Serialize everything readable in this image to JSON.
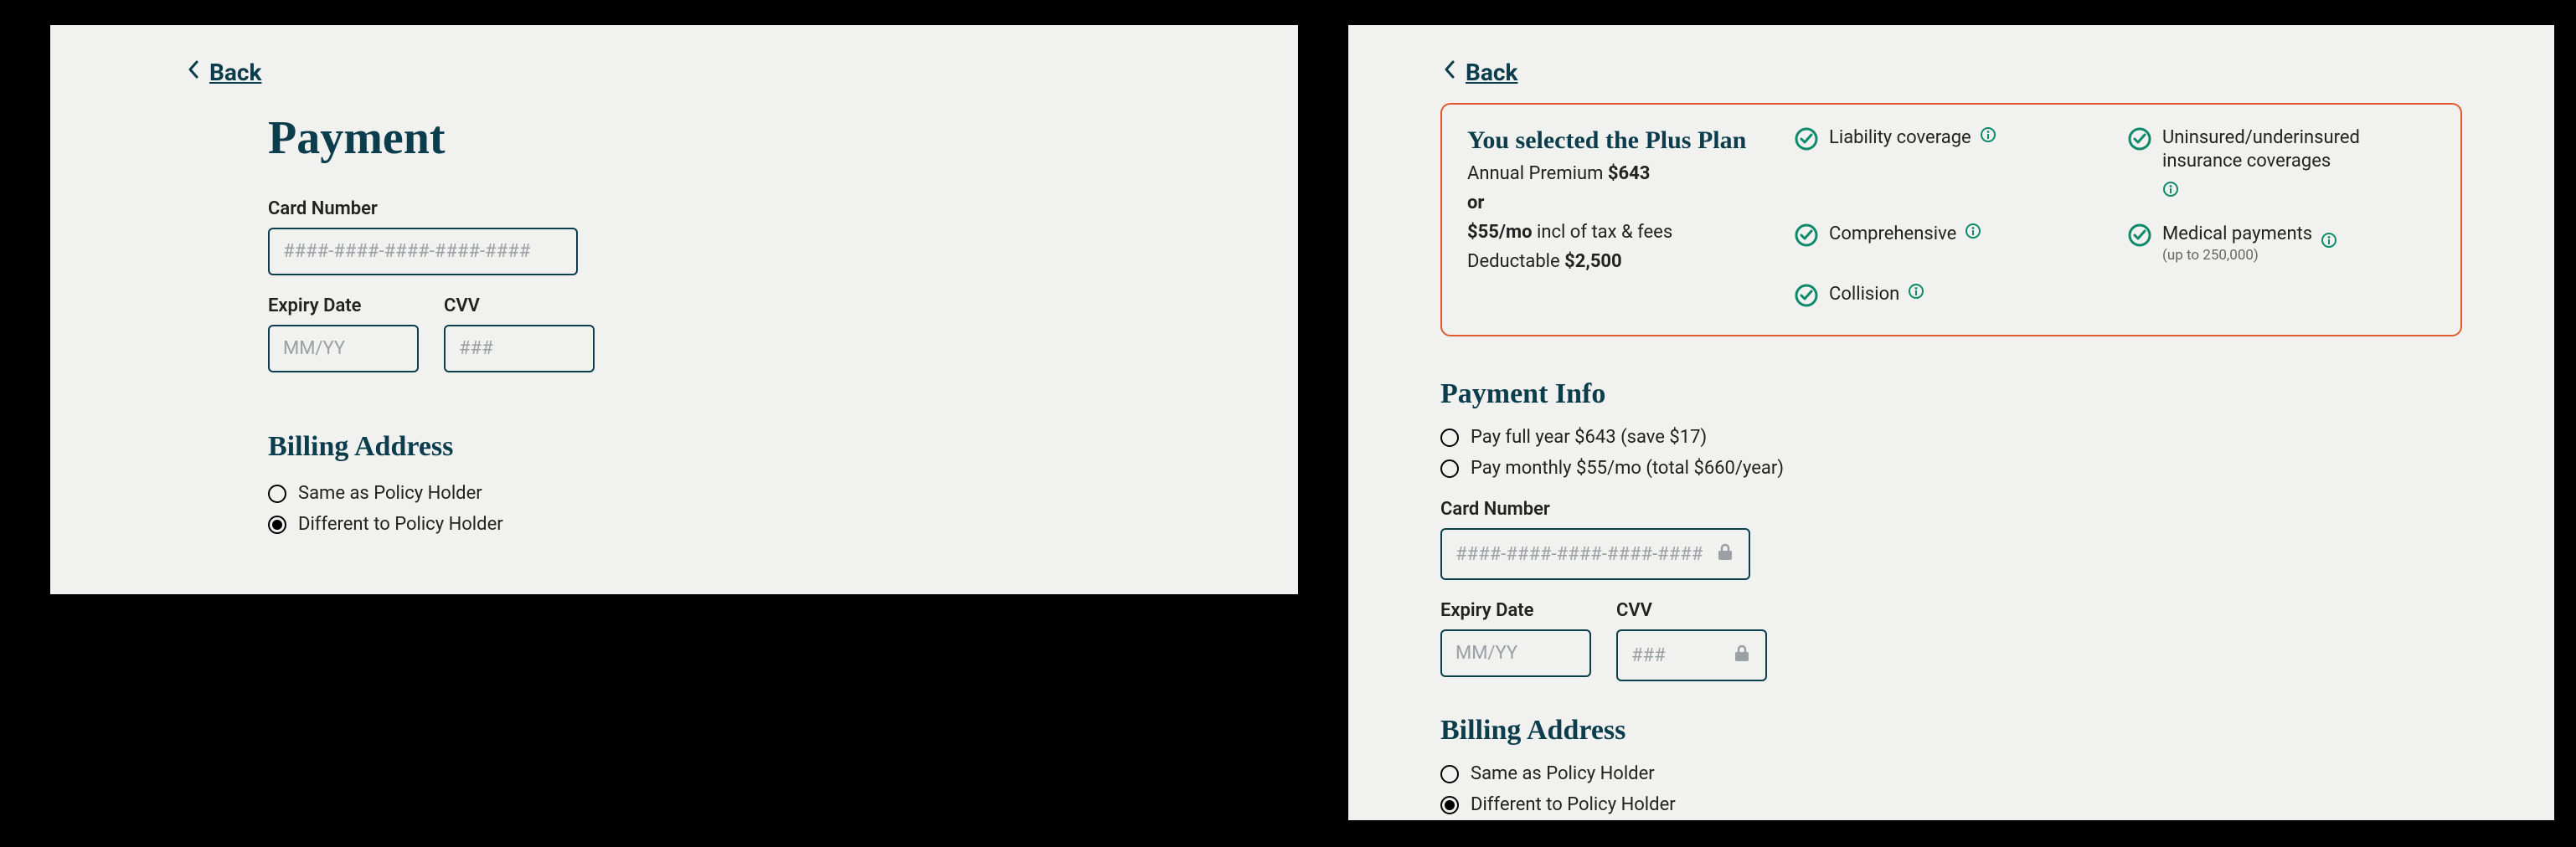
{
  "left": {
    "back": "Back",
    "title": "Payment",
    "cardNumber": {
      "label": "Card Number",
      "placeholder": "####-####-####-####-####"
    },
    "expiry": {
      "label": "Expiry Date",
      "placeholder": "MM/YY"
    },
    "cvv": {
      "label": "CVV",
      "placeholder": "###"
    },
    "billingTitle": "Billing Address",
    "billingSame": "Same as Policy Holder",
    "billingDiff": "Different to Policy Holder"
  },
  "right": {
    "back": "Back",
    "plan": {
      "title": "You selected the Plus Plan",
      "annualPremiumLabel": "Annual Premium ",
      "annualPremiumValue": "$643",
      "or": "or",
      "monthlyValue": "$55/mo",
      "monthlySuffix": " incl of tax & fees",
      "deductibleLabel": "Deductable ",
      "deductibleValue": "$2,500",
      "cov": {
        "liability": "Liability coverage",
        "comprehensive": "Comprehensive",
        "collision": "Collision",
        "uninsured": "Uninsured/underinsured insurance coverages",
        "medical": "Medical payments",
        "medicalSub": "(up to 250,000)"
      }
    },
    "paymentInfoTitle": "Payment Info",
    "payFull": "Pay full year $643 (save $17)",
    "payMonthly": "Pay monthly $55/mo (total $660/year)",
    "cardNumber": {
      "label": "Card Number",
      "placeholder": "####-####-####-####-####"
    },
    "expiry": {
      "label": "Expiry Date",
      "placeholder": "MM/YY"
    },
    "cvv": {
      "label": "CVV",
      "placeholder": "###"
    },
    "billingTitle": "Billing Address",
    "billingSame": "Same as Policy Holder",
    "billingDiff": "Different to Policy Holder"
  }
}
